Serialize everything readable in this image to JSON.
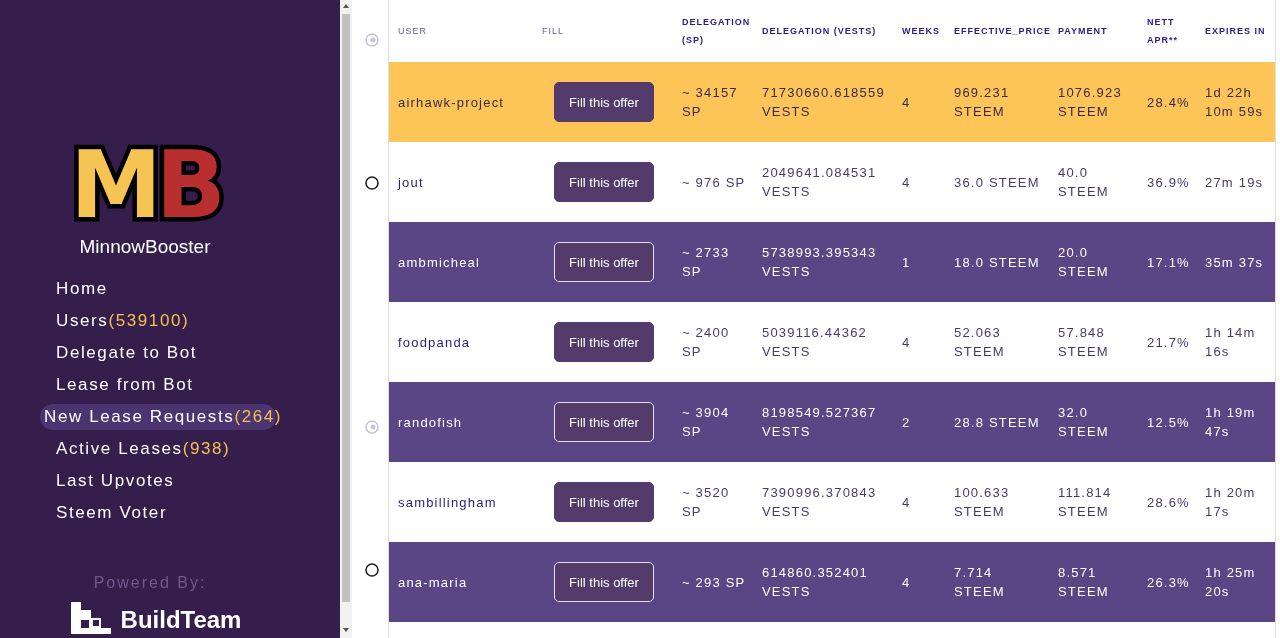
{
  "sidebar": {
    "logo": {
      "letters": [
        "M",
        "B"
      ],
      "name": "MinnowBooster"
    },
    "nav": [
      {
        "label": "Home",
        "selected": false
      },
      {
        "label": "Users",
        "count": "(539100)",
        "selected": false
      },
      {
        "label": "Delegate to Bot",
        "selected": false
      },
      {
        "label": "Lease from Bot",
        "selected": false
      },
      {
        "label": "New Lease Requests",
        "count": "(264)",
        "selected": true
      },
      {
        "label": "Active Leases",
        "count": "(938)",
        "selected": false
      },
      {
        "label": "Last Upvotes",
        "selected": false
      },
      {
        "label": "Steem Voter",
        "selected": false
      }
    ],
    "powered_by": "Powered By:",
    "partner": "BuildTeam"
  },
  "table": {
    "columns": [
      "USER",
      "FILL",
      "DELEGATION (SP)",
      "DELEGATION (VESTS)",
      "WEEKS",
      "EFFECTIVE_PRICE",
      "PAYMENT",
      "NETT APR**",
      "EXPIRES IN"
    ],
    "rows": [
      {
        "kind": "highlight",
        "user": "airhawk-project",
        "button": "Fill this offer",
        "sp": "~ 34157 SP",
        "vests": "71730660.618559 VESTS",
        "weeks": "4",
        "price": "969.231 STEEM",
        "payment": "1076.923 STEEM",
        "apr": "28.4%",
        "expires": "1d 22h 10m 59s"
      },
      {
        "kind": "light",
        "user": "jout",
        "button": "Fill this offer",
        "sp": "~ 976 SP",
        "vests": "2049641.084531 VESTS",
        "weeks": "4",
        "price": "36.0 STEEM",
        "payment": "40.0 STEEM",
        "apr": "36.9%",
        "expires": "27m 19s"
      },
      {
        "kind": "dark",
        "user": "ambmicheal",
        "button": "Fill this offer",
        "sp": "~ 2733 SP",
        "vests": "5738993.395343 VESTS",
        "weeks": "1",
        "price": "18.0 STEEM",
        "payment": "20.0 STEEM",
        "apr": "17.1%",
        "expires": "35m 37s"
      },
      {
        "kind": "light",
        "user": "foodpanda",
        "button": "Fill this offer",
        "sp": "~ 2400 SP",
        "vests": "5039116.44362 VESTS",
        "weeks": "4",
        "price": "52.063 STEEM",
        "payment": "57.848 STEEM",
        "apr": "21.7%",
        "expires": "1h 14m 16s"
      },
      {
        "kind": "dark",
        "user": "randofish",
        "button": "Fill this offer",
        "sp": "~ 3904 SP",
        "vests": "8198549.527367 VESTS",
        "weeks": "2",
        "price": "28.8 STEEM",
        "payment": "32.0 STEEM",
        "apr": "12.5%",
        "expires": "1h 19m 47s"
      },
      {
        "kind": "light",
        "user": "sambillingham",
        "button": "Fill this offer",
        "sp": "~ 3520 SP",
        "vests": "7390996.370843 VESTS",
        "weeks": "4",
        "price": "100.633 STEEM",
        "payment": "111.814 STEEM",
        "apr": "28.6%",
        "expires": "1h 20m 17s"
      },
      {
        "kind": "dark",
        "user": "ana-maria",
        "button": "Fill this offer",
        "sp": "~ 293 SP",
        "vests": "614860.352401 VESTS",
        "weeks": "4",
        "price": "7.714 STEEM",
        "payment": "8.571 STEEM",
        "apr": "26.3%",
        "expires": "1h 25m 20s"
      }
    ]
  }
}
